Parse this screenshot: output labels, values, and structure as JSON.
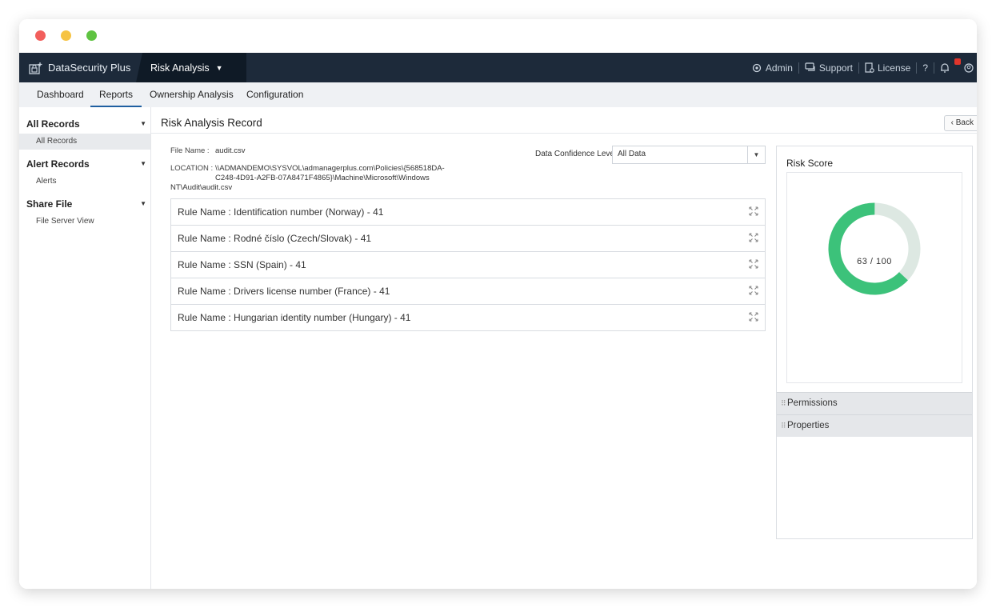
{
  "app": {
    "brand": "DataSecurity Plus",
    "module": "Risk Analysis"
  },
  "topbar": {
    "admin": "Admin",
    "support": "Support",
    "license": "License",
    "help": "?"
  },
  "tabs": [
    {
      "label": "Dashboard"
    },
    {
      "label": "Reports",
      "active": true
    },
    {
      "label": "Ownership Analysis"
    },
    {
      "label": "Configuration"
    }
  ],
  "sidebar": {
    "sections": [
      {
        "title": "All Records",
        "items": [
          "All Records"
        ]
      },
      {
        "title": "Alert Records",
        "items": [
          "Alerts"
        ]
      },
      {
        "title": "Share File",
        "items": [
          "File Server View"
        ]
      }
    ]
  },
  "main": {
    "title": "Risk Analysis Record",
    "back": "Back",
    "file_name_label": "File Name :",
    "file_name": "audit.csv",
    "location_label": "LOCATION :",
    "location_line1": "\\\\ADMANDEMO\\SYSVOL\\admanagerplus.com\\Policies\\{568518DA-",
    "location_line2": "C248-4D91-A2FB-07A8471F4865}\\Machine\\Microsoft\\Windows",
    "location_line3": "NT\\Audit\\audit.csv",
    "confidence_label": "Data Confidence Level",
    "confidence_value": "All Data",
    "rules": [
      "Rule Name : Identification number (Norway) - 41",
      "Rule Name : Rodné číslo (Czech/Slovak) - 41",
      "Rule Name : SSN (Spain) - 41",
      "Rule Name : Drivers license number (France) - 41",
      "Rule Name : Hungarian identity number (Hungary) - 41"
    ]
  },
  "risk": {
    "title": "Risk Score",
    "score": 63,
    "max": 100,
    "score_text": "63 / 100",
    "color_fill": "#3cc27a",
    "color_track": "#dde8e2",
    "permissions": "Permissions",
    "properties": "Properties"
  }
}
